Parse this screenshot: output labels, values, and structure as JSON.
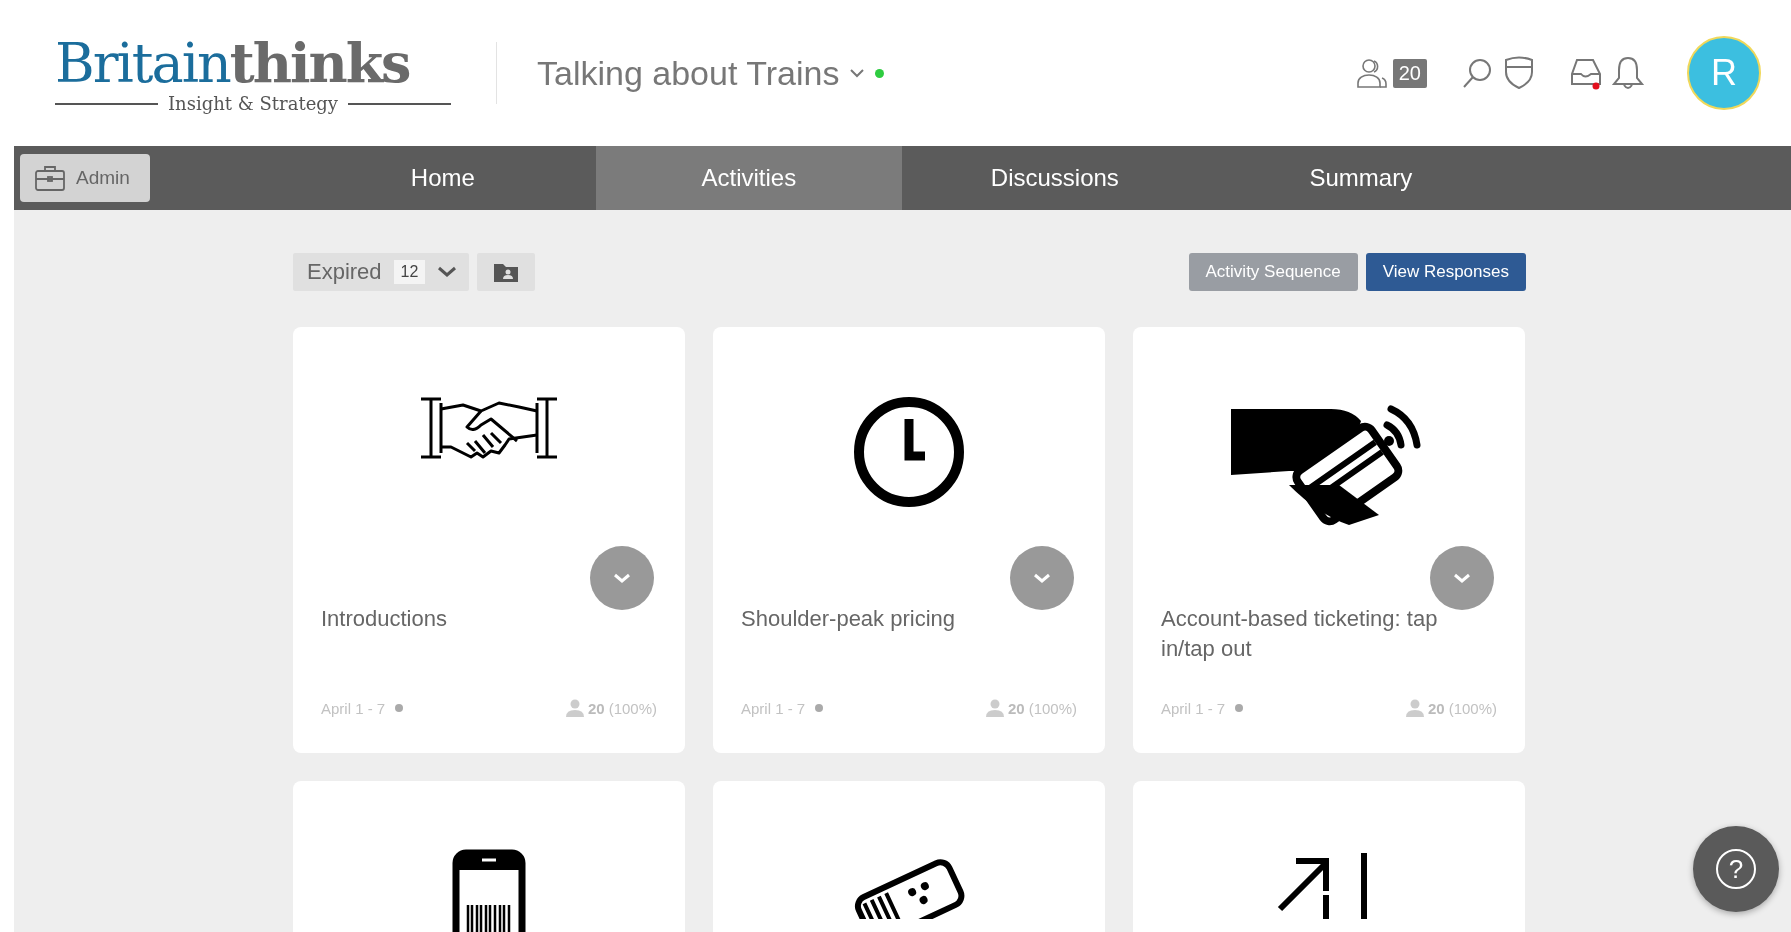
{
  "header": {
    "logo": {
      "brand_first": "Britain",
      "brand_second": "thinks",
      "tagline": "Insight & Strategy"
    },
    "project": {
      "title": "Talking about Trains",
      "online": true
    },
    "participants": "20",
    "inbox_unread": true,
    "avatar": {
      "initial": "R"
    }
  },
  "nav": {
    "admin": "Admin",
    "tabs": [
      {
        "label": "Home",
        "selected": false
      },
      {
        "label": "Activities",
        "selected": true
      },
      {
        "label": "Discussions",
        "selected": false
      },
      {
        "label": "Summary",
        "selected": false
      }
    ]
  },
  "toolbar": {
    "filter": {
      "label": "Expired",
      "count": "12"
    },
    "buttons": [
      {
        "label": "Activity Sequence",
        "kind": "secondary"
      },
      {
        "label": "View Responses",
        "kind": "primary"
      }
    ]
  },
  "cards": [
    {
      "kind": "handshake",
      "title": "Introductions",
      "dates": "April 1 - 7",
      "count": "20",
      "percent": "(100%)"
    },
    {
      "kind": "clock",
      "title": "Shoulder-peak pricing",
      "dates": "April 1 - 7",
      "count": "20",
      "percent": "(100%)"
    },
    {
      "kind": "card-tap",
      "title": "Account-based ticketing: tap in/tap out",
      "dates": "April 1 - 7",
      "count": "20",
      "percent": "(100%)"
    },
    {
      "kind": "phone-barcode"
    },
    {
      "kind": "ticket"
    },
    {
      "kind": "arrows"
    }
  ],
  "help": {
    "label": "?"
  }
}
